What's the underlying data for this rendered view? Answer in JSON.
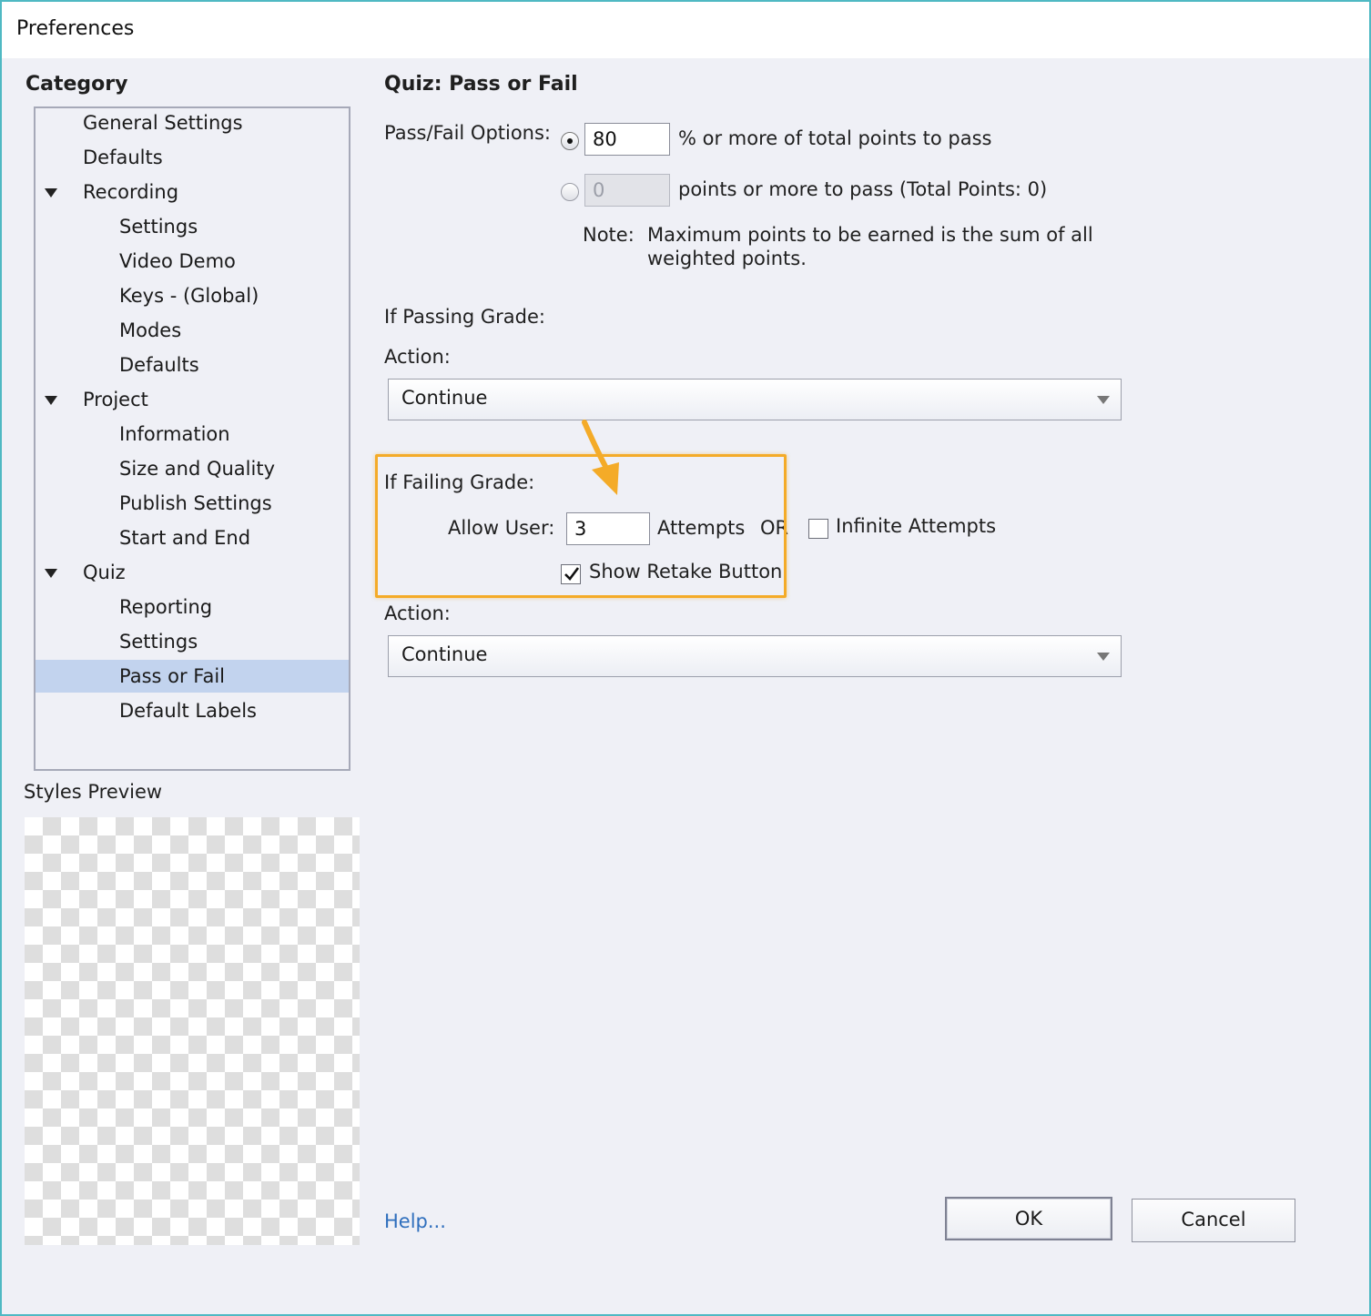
{
  "window": {
    "title": "Preferences"
  },
  "sidebar": {
    "category_label": "Category",
    "items": [
      {
        "label": "General Settings",
        "level": 0,
        "expandable": false
      },
      {
        "label": "Defaults",
        "level": 0,
        "expandable": false
      },
      {
        "label": "Recording",
        "level": 0,
        "expandable": true
      },
      {
        "label": "Settings",
        "level": 1,
        "expandable": false
      },
      {
        "label": "Video Demo",
        "level": 1,
        "expandable": false
      },
      {
        "label": "Keys - (Global)",
        "level": 1,
        "expandable": false
      },
      {
        "label": "Modes",
        "level": 1,
        "expandable": false
      },
      {
        "label": "Defaults",
        "level": 1,
        "expandable": false
      },
      {
        "label": "Project",
        "level": 0,
        "expandable": true
      },
      {
        "label": "Information",
        "level": 1,
        "expandable": false
      },
      {
        "label": "Size and Quality",
        "level": 1,
        "expandable": false
      },
      {
        "label": "Publish Settings",
        "level": 1,
        "expandable": false
      },
      {
        "label": "Start and End",
        "level": 1,
        "expandable": false
      },
      {
        "label": "Quiz",
        "level": 0,
        "expandable": true
      },
      {
        "label": "Reporting",
        "level": 1,
        "expandable": false
      },
      {
        "label": "Settings",
        "level": 1,
        "expandable": false
      },
      {
        "label": "Pass or Fail",
        "level": 1,
        "expandable": false,
        "selected": true
      },
      {
        "label": "Default Labels",
        "level": 1,
        "expandable": false
      }
    ],
    "styles_preview_label": "Styles Preview"
  },
  "main": {
    "heading": "Quiz: Pass or Fail",
    "pass_fail": {
      "label": "Pass/Fail Options:",
      "option_percent": {
        "selected": true,
        "value": "80",
        "suffix": "% or more of total points to pass"
      },
      "option_points": {
        "selected": false,
        "value": "0",
        "disabled": true,
        "suffix": "points or more to pass (Total Points: 0)"
      },
      "note_label": "Note:",
      "note_line1": "Maximum points to be earned is the sum of all",
      "note_line2": "weighted points."
    },
    "passing": {
      "heading": "If Passing Grade:",
      "action_label": "Action:",
      "action_value": "Continue"
    },
    "failing": {
      "heading": "If Failing Grade:",
      "allow_user_label": "Allow User:",
      "attempts_value": "3",
      "attempts_label": "Attempts",
      "or_label": "OR",
      "infinite_attempts_label": "Infinite Attempts",
      "infinite_attempts_checked": false,
      "show_retake_label": "Show Retake Button",
      "show_retake_checked": true,
      "action_label": "Action:",
      "action_value": "Continue"
    },
    "annotation_color": "#f4ab28"
  },
  "footer": {
    "help_link": "Help...",
    "ok_button": "OK",
    "cancel_button": "Cancel"
  }
}
